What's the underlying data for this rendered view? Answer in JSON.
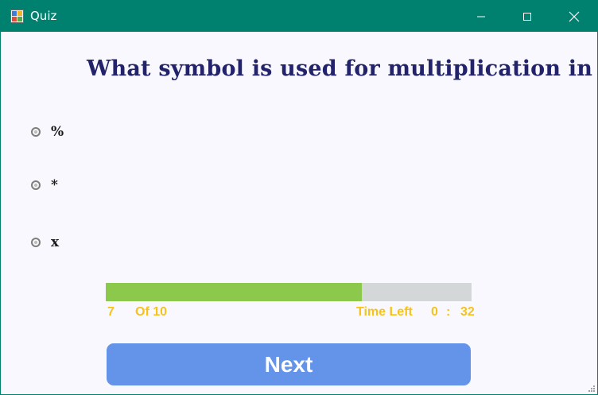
{
  "window": {
    "title": "Quiz"
  },
  "question": "What symbol is used for multiplication in C#?",
  "options": [
    {
      "label": "%"
    },
    {
      "label": "*"
    },
    {
      "label": "x"
    }
  ],
  "progress": {
    "current": "7",
    "of_label": "Of 10",
    "fraction": 0.7
  },
  "timer": {
    "label": "Time Left",
    "minutes": "0",
    "sep": ":",
    "seconds": "32"
  },
  "next_button": {
    "label": "Next"
  },
  "colors": {
    "titlebar": "#00806e",
    "question": "#23236b",
    "progress_fill": "#8bc84b",
    "progress_track": "#d3d7d8",
    "info_text": "#f5c31a",
    "button": "#6494ea"
  }
}
